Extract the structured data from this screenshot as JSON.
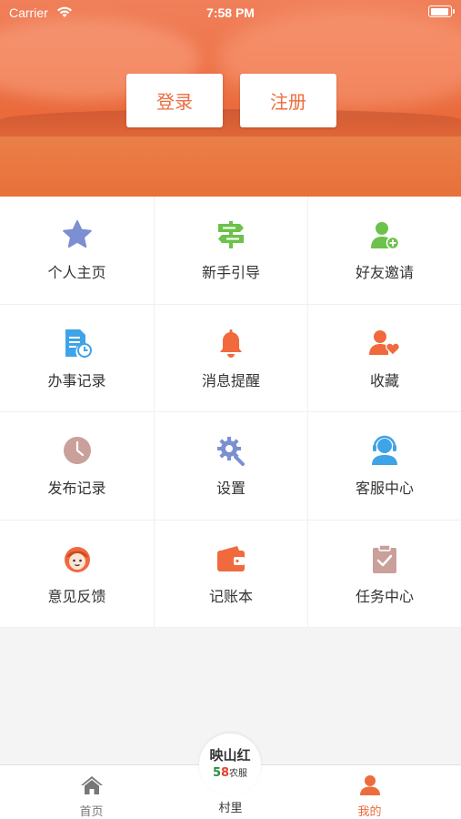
{
  "status_bar": {
    "carrier": "Carrier",
    "time": "7:58 PM"
  },
  "header": {
    "login_label": "登录",
    "register_label": "注册"
  },
  "menu": [
    {
      "label": "个人主页",
      "icon": "star-icon",
      "color": "#7b8fd1"
    },
    {
      "label": "新手引导",
      "icon": "signpost-icon",
      "color": "#6cc24a"
    },
    {
      "label": "好友邀请",
      "icon": "add-user-icon",
      "color": "#6cc24a"
    },
    {
      "label": "办事记录",
      "icon": "document-clock-icon",
      "color": "#3fa3e8"
    },
    {
      "label": "消息提醒",
      "icon": "bell-icon",
      "color": "#f06a3d"
    },
    {
      "label": "收藏",
      "icon": "user-heart-icon",
      "color": "#f06a3d"
    },
    {
      "label": "发布记录",
      "icon": "clock-icon",
      "color": "#c9a09a"
    },
    {
      "label": "设置",
      "icon": "gear-icon",
      "color": "#7b8fd1"
    },
    {
      "label": "客服中心",
      "icon": "headset-icon",
      "color": "#3fa3e8"
    },
    {
      "label": "意见反馈",
      "icon": "face-icon",
      "color": "#f06a3d"
    },
    {
      "label": "记账本",
      "icon": "wallet-icon",
      "color": "#f06a3d"
    },
    {
      "label": "任务中心",
      "icon": "clipboard-check-icon",
      "color": "#c9a09a"
    }
  ],
  "tabbar": {
    "home_label": "首页",
    "village_label": "村里",
    "mine_label": "我的",
    "badge_title": "映山红",
    "badge_sub_5": "5",
    "badge_sub_8": "8",
    "badge_sub_text": "农服"
  },
  "colors": {
    "accent": "#ed6c3d"
  }
}
